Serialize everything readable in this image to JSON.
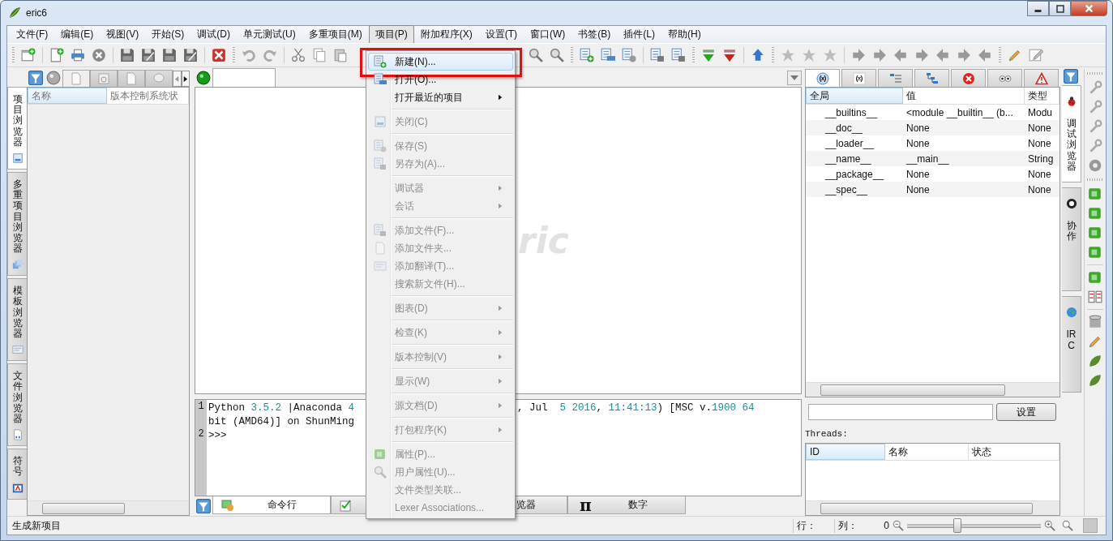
{
  "window": {
    "title": "eric6"
  },
  "menu_bar": [
    {
      "label": "文件(F)",
      "selected": false
    },
    {
      "label": "编辑(E)",
      "selected": false
    },
    {
      "label": "视图(V)",
      "selected": false
    },
    {
      "label": "开始(S)",
      "selected": false
    },
    {
      "label": "调试(D)",
      "selected": false
    },
    {
      "label": "单元测试(U)",
      "selected": false
    },
    {
      "label": "多重项目(M)",
      "selected": false
    },
    {
      "label": "项目(P)",
      "selected": true
    },
    {
      "label": "附加程序(X)",
      "selected": false
    },
    {
      "label": "设置(T)",
      "selected": false
    },
    {
      "label": "窗口(W)",
      "selected": false
    },
    {
      "label": "书签(B)",
      "selected": false
    },
    {
      "label": "插件(L)",
      "selected": false
    },
    {
      "label": "帮助(H)",
      "selected": false
    }
  ],
  "project_menu": {
    "items": [
      {
        "kind": "item",
        "label": "新建(N)...",
        "icon": true,
        "disabled": false,
        "submenu": false,
        "selected": true,
        "annotated": true
      },
      {
        "kind": "item",
        "label": "打开(O)...",
        "icon": true,
        "disabled": false,
        "submenu": false,
        "selected": false,
        "annotated": false
      },
      {
        "kind": "item",
        "label": "打开最近的项目",
        "icon": false,
        "disabled": false,
        "submenu": true,
        "selected": false,
        "annotated": false
      },
      {
        "kind": "separator"
      },
      {
        "kind": "item",
        "label": "关闭(C)",
        "icon": true,
        "disabled": true,
        "submenu": false,
        "selected": false,
        "annotated": false
      },
      {
        "kind": "separator"
      },
      {
        "kind": "item",
        "label": "保存(S)",
        "icon": true,
        "disabled": true,
        "submenu": false,
        "selected": false,
        "annotated": false
      },
      {
        "kind": "item",
        "label": "另存为(A)...",
        "icon": true,
        "disabled": true,
        "submenu": false,
        "selected": false,
        "annotated": false
      },
      {
        "kind": "separator"
      },
      {
        "kind": "item",
        "label": "调试器",
        "icon": false,
        "disabled": true,
        "submenu": true,
        "selected": false,
        "annotated": false
      },
      {
        "kind": "item",
        "label": "会话",
        "icon": false,
        "disabled": true,
        "submenu": true,
        "selected": false,
        "annotated": false
      },
      {
        "kind": "separator"
      },
      {
        "kind": "item",
        "label": "添加文件(F)...",
        "icon": true,
        "disabled": true,
        "submenu": false,
        "selected": false,
        "annotated": false
      },
      {
        "kind": "item",
        "label": "添加文件夹...",
        "icon": true,
        "disabled": true,
        "submenu": false,
        "selected": false,
        "annotated": false
      },
      {
        "kind": "item",
        "label": "添加翻译(T)...",
        "icon": true,
        "disabled": true,
        "submenu": false,
        "selected": false,
        "annotated": false
      },
      {
        "kind": "item",
        "label": "搜索新文件(H)...",
        "icon": false,
        "disabled": true,
        "submenu": false,
        "selected": false,
        "annotated": false
      },
      {
        "kind": "separator"
      },
      {
        "kind": "item",
        "label": "图表(D)",
        "icon": false,
        "disabled": true,
        "submenu": true,
        "selected": false,
        "annotated": false
      },
      {
        "kind": "separator"
      },
      {
        "kind": "item",
        "label": "检查(K)",
        "icon": false,
        "disabled": true,
        "submenu": true,
        "selected": false,
        "annotated": false
      },
      {
        "kind": "separator"
      },
      {
        "kind": "item",
        "label": "版本控制(V)",
        "icon": false,
        "disabled": true,
        "submenu": true,
        "selected": false,
        "annotated": false
      },
      {
        "kind": "separator"
      },
      {
        "kind": "item",
        "label": "显示(W)",
        "icon": false,
        "disabled": true,
        "submenu": true,
        "selected": false,
        "annotated": false
      },
      {
        "kind": "separator"
      },
      {
        "kind": "item",
        "label": "源文档(D)",
        "icon": false,
        "disabled": true,
        "submenu": true,
        "selected": false,
        "annotated": false
      },
      {
        "kind": "separator"
      },
      {
        "kind": "item",
        "label": "打包程序(K)",
        "icon": false,
        "disabled": true,
        "submenu": true,
        "selected": false,
        "annotated": false
      },
      {
        "kind": "separator"
      },
      {
        "kind": "item",
        "label": "属性(P)...",
        "icon": true,
        "disabled": true,
        "submenu": false,
        "selected": false,
        "annotated": false
      },
      {
        "kind": "item",
        "label": "用户属性(U)...",
        "icon": true,
        "disabled": true,
        "submenu": false,
        "selected": false,
        "annotated": false
      },
      {
        "kind": "item",
        "label": "文件类型关联...",
        "icon": false,
        "disabled": true,
        "submenu": false,
        "selected": false,
        "annotated": false
      },
      {
        "kind": "item",
        "label": "Lexer Associations...",
        "icon": false,
        "disabled": true,
        "submenu": false,
        "selected": false,
        "annotated": false
      }
    ]
  },
  "left_panel": {
    "vertical_tabs": [
      {
        "label": "项目浏览器",
        "selected": true
      },
      {
        "label": "多重项目浏览器",
        "selected": false
      },
      {
        "label": "模板浏览器",
        "selected": false
      },
      {
        "label": "文件浏览器",
        "selected": false
      },
      {
        "label": "符号",
        "selected": false
      }
    ],
    "tabs": [
      {
        "kind": "sources",
        "selected": true
      },
      {
        "kind": "forms",
        "selected": false
      },
      {
        "kind": "resources",
        "selected": false
      },
      {
        "kind": "translations",
        "selected": false
      }
    ],
    "tree": {
      "columns": [
        "名称",
        "版本控制系统状"
      ]
    }
  },
  "editor": {
    "logo": "ric"
  },
  "shell": {
    "lines": [
      {
        "number": "1",
        "left": [
          {
            "text": "Python ",
            "kind": "plain"
          },
          {
            "text": "3.5.2",
            "kind": "number"
          },
          {
            "text": " |Anaconda ",
            "kind": "plain"
          },
          {
            "text": "4",
            "kind": "number"
          }
        ],
        "right": [
          {
            "text": ", Jul  ",
            "kind": "plain"
          },
          {
            "text": "5 2016",
            "kind": "number"
          },
          {
            "text": ", ",
            "kind": "plain"
          },
          {
            "text": "11:41:13",
            "kind": "number"
          },
          {
            "text": ") [MSC v.",
            "kind": "plain"
          },
          {
            "text": "1900 64",
            "kind": "number"
          }
        ]
      },
      {
        "left": [
          {
            "text": "bit (AMD64)] on ShunMing",
            "kind": "plain"
          }
        ]
      },
      {
        "number": "2",
        "left": [
          {
            "text": ">>>",
            "kind": "plain"
          }
        ]
      }
    ]
  },
  "bottom_tabs": [
    {
      "kind": "shell",
      "label": "命令行",
      "selected": true
    },
    {
      "kind": "tasks",
      "selected": false
    },
    {
      "kind": "browser",
      "label": "览器",
      "selected": false
    },
    {
      "kind": "numbers",
      "glyph": "π",
      "label": "数字",
      "selected": false
    }
  ],
  "debug_viewer": {
    "tabs": [
      {
        "kind": "globals",
        "selected": true
      },
      {
        "kind": "locals",
        "selected": false
      },
      {
        "kind": "stack",
        "selected": false
      },
      {
        "kind": "threads",
        "selected": false
      },
      {
        "kind": "exceptions",
        "selected": false
      },
      {
        "kind": "watch",
        "selected": false
      },
      {
        "kind": "breakpoints",
        "selected": false
      }
    ],
    "variables": {
      "columns": [
        "全局",
        "值",
        "类型"
      ],
      "rows": [
        [
          "__builtins__",
          "<module __builtin__ (b...",
          "Modu"
        ],
        [
          "__doc__",
          "None",
          "None"
        ],
        [
          "__loader__",
          "None",
          "None"
        ],
        [
          "__name__",
          "__main__",
          "String"
        ],
        [
          "__package__",
          "None",
          "None"
        ],
        [
          "__spec__",
          "None",
          "None"
        ]
      ]
    },
    "filter_button": "设置",
    "threads": {
      "label": "Threads:",
      "columns": [
        "ID",
        "名称",
        "状态"
      ]
    }
  },
  "right_vertical_tabs": [
    {
      "kind": "debug",
      "label": "调试浏览器",
      "selected": true
    },
    {
      "kind": "cooperation",
      "label": "协作",
      "selected": false
    },
    {
      "kind": "irc",
      "label": "IRC",
      "selected": false
    }
  ],
  "status_bar": {
    "message": "生成新项目",
    "line_label": "行：",
    "column_label": "列：",
    "zoom_value": "0",
    "zoom": {
      "level": 0.37
    }
  }
}
